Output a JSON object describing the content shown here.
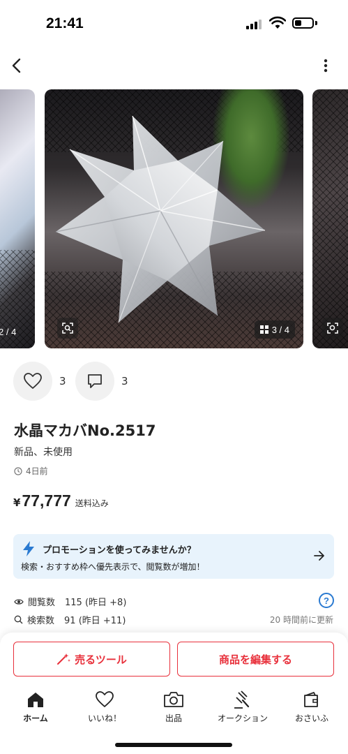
{
  "status_bar": {
    "time": "21:41"
  },
  "carousel": {
    "prev_counter": "2 / 4",
    "current_counter": "3 / 4"
  },
  "reactions": {
    "likes": "3",
    "comments": "3"
  },
  "item": {
    "title": "水晶マカバNo.2517",
    "condition": "新品、未使用",
    "posted": "4日前",
    "price_symbol": "¥",
    "price": "77,777",
    "shipping": "送料込み"
  },
  "promotion": {
    "title": "プロモーションを使ってみませんか？",
    "description": "検索・おすすめ枠へ優先表示で、閲覧数が増加！"
  },
  "stats": {
    "views_label": "閲覧数",
    "views_value": "115 (昨日 +8)",
    "search_label": "検索数",
    "search_value": "91 (昨日 +11)",
    "updated": "20 時間前に更新",
    "help": "?"
  },
  "actions": {
    "sell_tool": "売るツール",
    "edit_item": "商品を編集する"
  },
  "tabs": [
    {
      "label": "ホーム",
      "icon": "home-icon",
      "active": true
    },
    {
      "label": "いいね！",
      "icon": "heart-icon",
      "active": false
    },
    {
      "label": "出品",
      "icon": "camera-icon",
      "active": false
    },
    {
      "label": "オークション",
      "icon": "gavel-icon",
      "active": false
    },
    {
      "label": "おさいふ",
      "icon": "wallet-icon",
      "active": false
    }
  ],
  "colors": {
    "accent_red": "#e8303b",
    "promo_bg": "#e8f3fc",
    "help_blue": "#2a7ad1"
  }
}
